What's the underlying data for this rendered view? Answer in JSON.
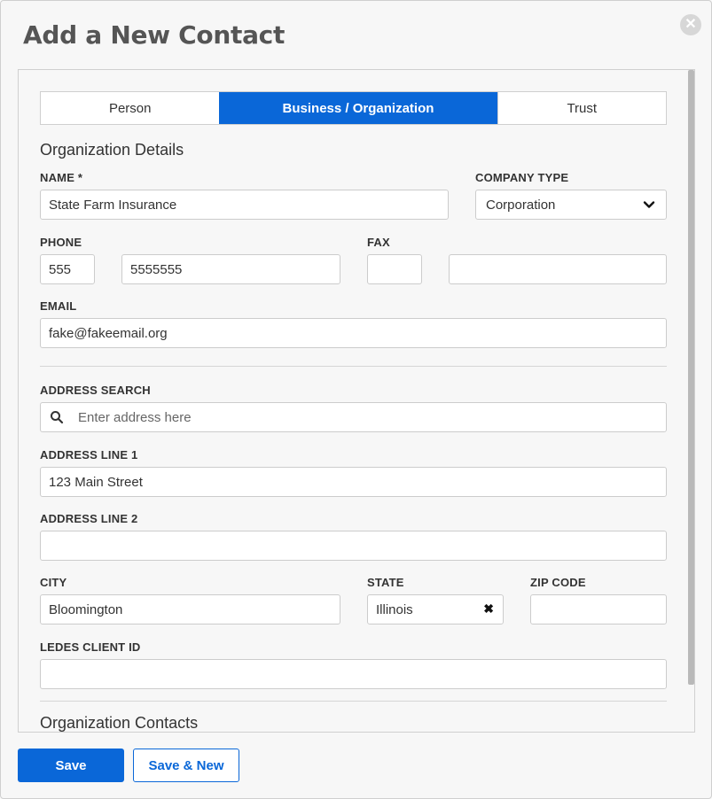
{
  "modal": {
    "title": "Add a New Contact",
    "close_icon": "close-icon"
  },
  "tabs": [
    {
      "label": "Person",
      "active": false
    },
    {
      "label": "Business / Organization",
      "active": true
    },
    {
      "label": "Trust",
      "active": false
    }
  ],
  "sections": {
    "org_details": "Organization Details",
    "org_contacts": "Organization Contacts"
  },
  "fields": {
    "name": {
      "label": "NAME *",
      "value": "State Farm Insurance"
    },
    "company_type": {
      "label": "COMPANY TYPE",
      "value": "Corporation"
    },
    "phone": {
      "label": "PHONE",
      "area": "555",
      "number": "5555555"
    },
    "fax": {
      "label": "FAX",
      "area": "",
      "number": ""
    },
    "email": {
      "label": "EMAIL",
      "value": "fake@fakeemail.org"
    },
    "address_search": {
      "label": "ADDRESS SEARCH",
      "placeholder": "Enter address here"
    },
    "address1": {
      "label": "ADDRESS LINE 1",
      "value": "123 Main Street"
    },
    "address2": {
      "label": "ADDRESS LINE 2",
      "value": ""
    },
    "city": {
      "label": "CITY",
      "value": "Bloomington"
    },
    "state": {
      "label": "STATE",
      "value": "Illinois"
    },
    "zip": {
      "label": "ZIP CODE",
      "value": ""
    },
    "ledes": {
      "label": "LEDES CLIENT ID",
      "value": ""
    }
  },
  "buttons": {
    "save": "Save",
    "save_new": "Save & New"
  },
  "colors": {
    "accent": "#0a67d8"
  }
}
